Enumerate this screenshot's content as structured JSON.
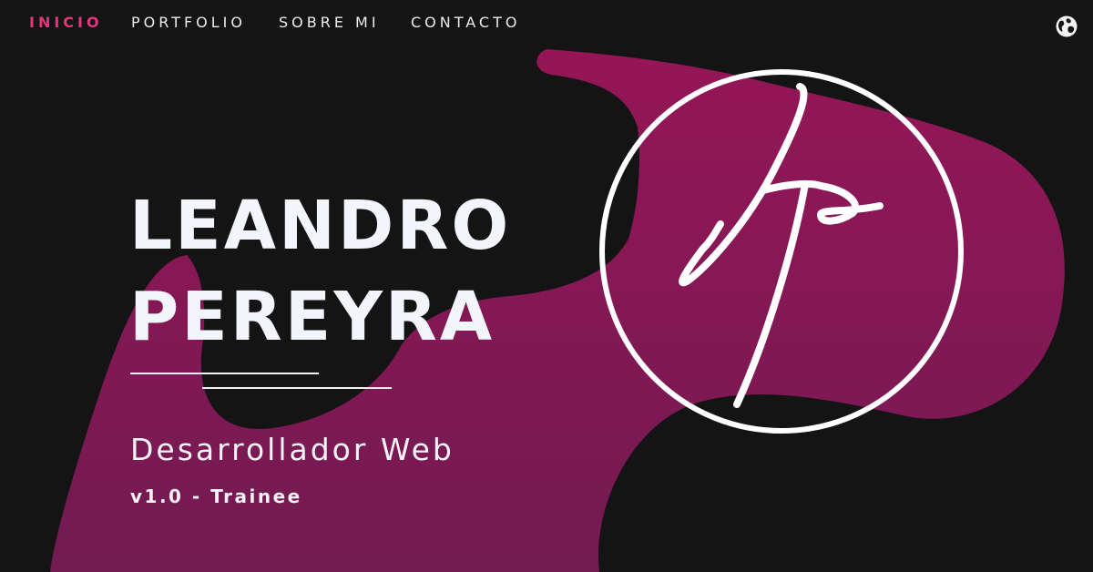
{
  "nav": {
    "items": [
      {
        "label": "INICIO",
        "active": true
      },
      {
        "label": "PORTFOLIO",
        "active": false
      },
      {
        "label": "SOBRE MI",
        "active": false
      },
      {
        "label": "CONTACTO",
        "active": false
      }
    ],
    "language_icon": "globe-icon"
  },
  "hero": {
    "name_line1": "LEANDRO",
    "name_line2": "PEREYRA",
    "role": "Desarrollador Web",
    "version": "v1.0 - Trainee"
  },
  "logo": {
    "monogram": "lp",
    "icon": "lp-monogram-logo"
  },
  "colors": {
    "background": "#141414",
    "accent": "#e2377f",
    "blob_top": "#951657",
    "blob_bottom": "#721a52",
    "text": "#f2f5fb"
  }
}
